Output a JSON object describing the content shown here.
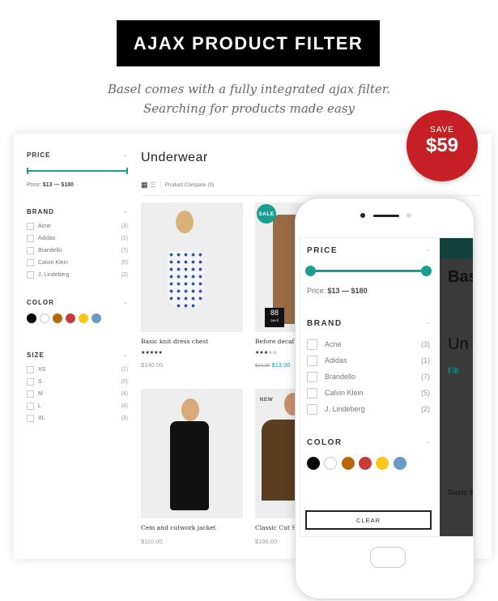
{
  "header": {
    "title": "AJAX PRODUCT FILTER",
    "subtitle_line1": "Basel comes with a fully integrated ajax filter.",
    "subtitle_line2": "Searching for products made easy"
  },
  "promo": {
    "label": "SAVE",
    "amount": "$59",
    "color": "#c62026"
  },
  "accent": "#1a9e8f",
  "filters": {
    "price": {
      "title": "PRICE",
      "label": "Price:",
      "range": "$13 — $180",
      "min": 13,
      "max": 180
    },
    "brand": {
      "title": "BRAND",
      "items": [
        {
          "name": "Acne",
          "count": "(3)"
        },
        {
          "name": "Adidas",
          "count": "(1)"
        },
        {
          "name": "Brandello",
          "count": "(7)"
        },
        {
          "name": "Calvin Klein",
          "count": "(5)"
        },
        {
          "name": "J. Lindeberg",
          "count": "(2)"
        }
      ]
    },
    "color": {
      "title": "COLOR",
      "swatches": [
        "#000000",
        "#ffffff",
        "#b8680c",
        "#c83a3e",
        "#fbc616",
        "#6b9ac4"
      ]
    },
    "size": {
      "title": "SIZE",
      "items": [
        {
          "name": "XS",
          "count": "(1)"
        },
        {
          "name": "S",
          "count": "(5)"
        },
        {
          "name": "M",
          "count": "(4)"
        },
        {
          "name": "L",
          "count": "(4)"
        },
        {
          "name": "XL",
          "count": "(3)"
        }
      ]
    }
  },
  "main": {
    "title": "Underwear",
    "compare": "Product Compare (0)"
  },
  "products": [
    {
      "name": "Basic knit dress chest",
      "rating": 5,
      "stars": "★★★★★",
      "price": "$140.00"
    },
    {
      "name": "Before decaf pl",
      "badge": "SALE",
      "rating": 3,
      "stars": "★★★☆☆",
      "old_price": "$14.00",
      "price": "$13.00",
      "countdown": {
        "value": "88",
        "unit": "DAYS"
      }
    },
    {
      "name": "Cem and cutwork jacket",
      "price": "$110.00"
    },
    {
      "name": "Classic Cut San",
      "badge": "NEW",
      "price": "$100.00"
    }
  ],
  "phone": {
    "clear": "CLEAR",
    "bg_title": "Bas",
    "bg_heading": "Un",
    "bg_filter": "Filt",
    "bg_product": "Basic k"
  }
}
